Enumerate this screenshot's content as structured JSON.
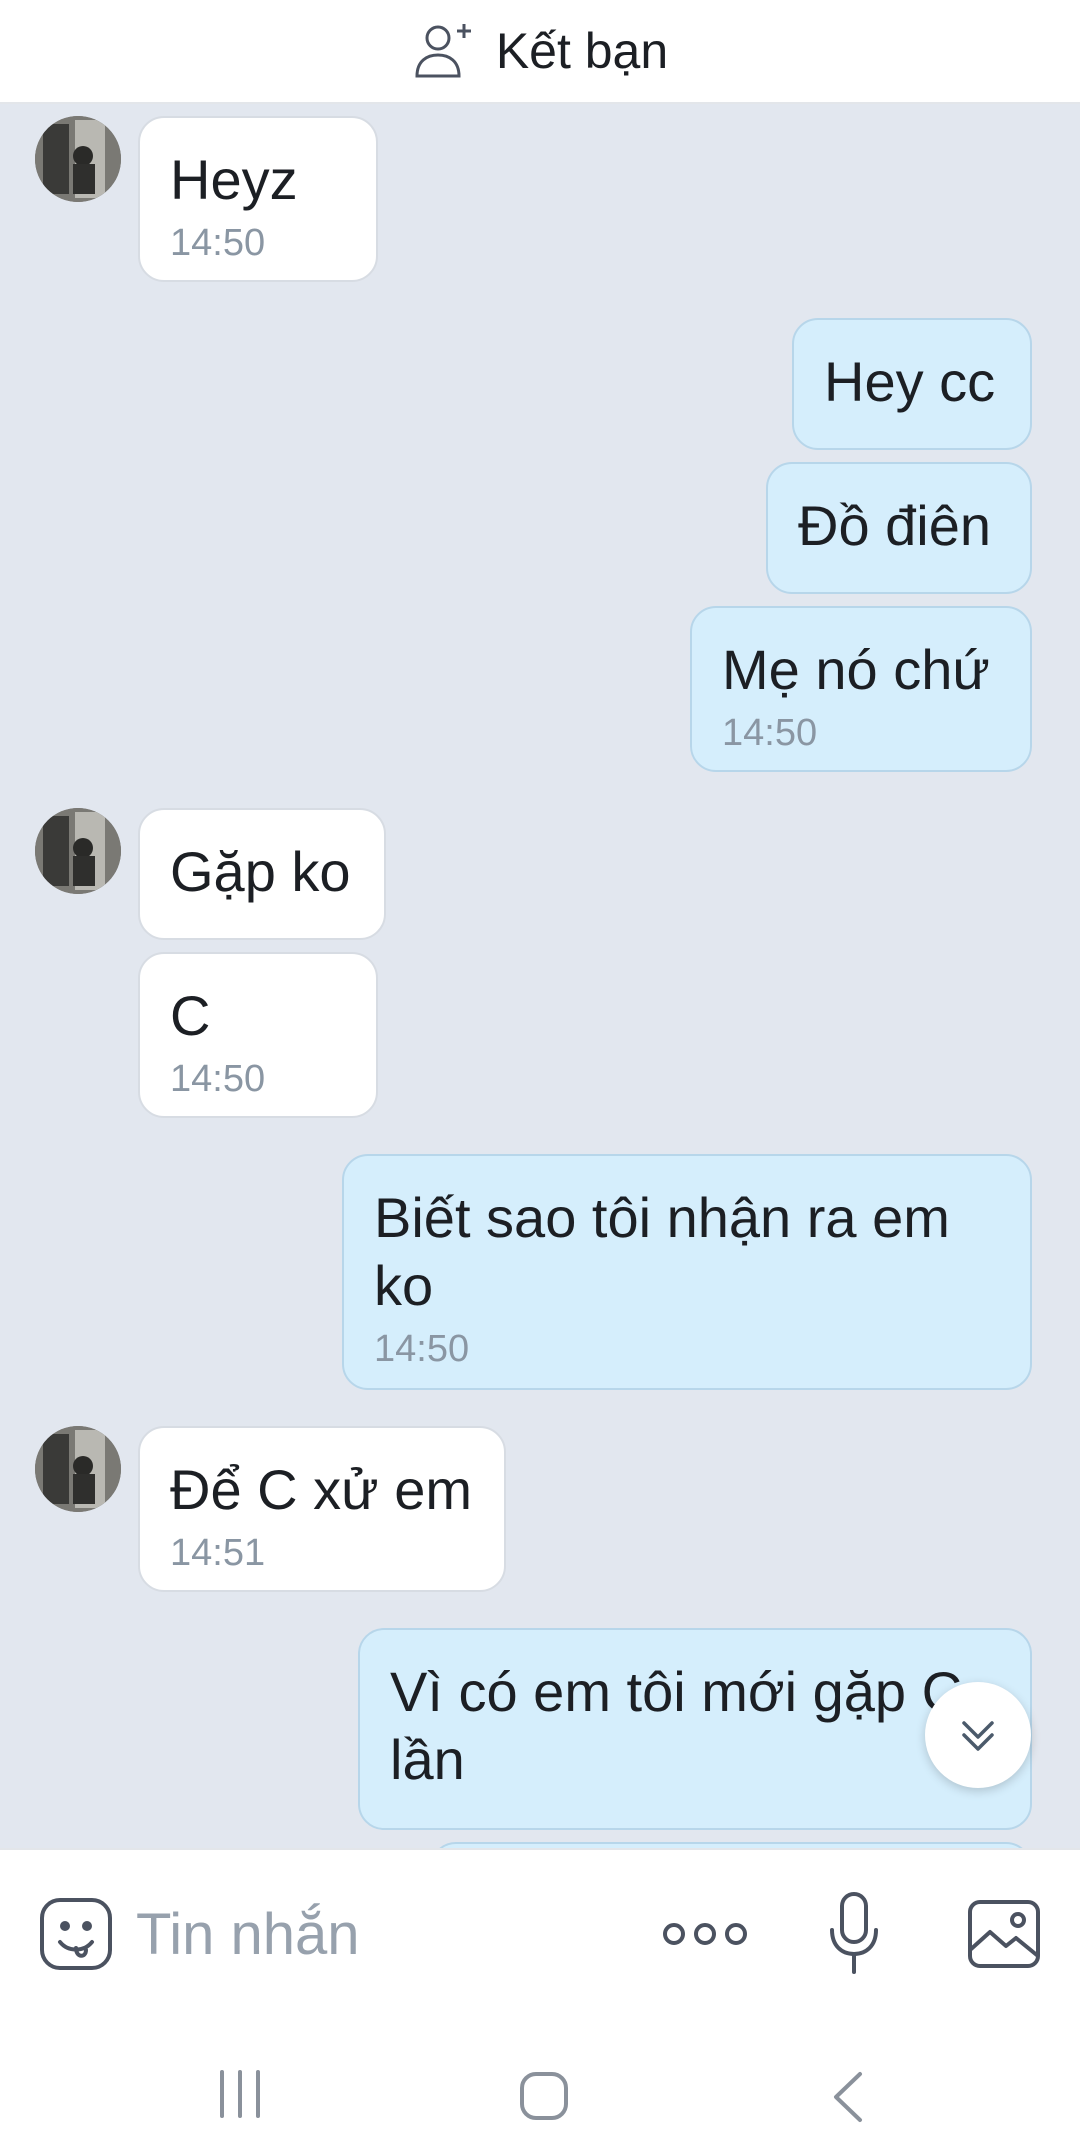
{
  "header": {
    "add_friend_label": "Kết bạn",
    "add_friend_icon": "add-user-icon"
  },
  "messages": [
    {
      "sender": "them",
      "text": "Heyz",
      "time": "14:50"
    },
    {
      "sender": "me",
      "text": "Hey cc",
      "time": ""
    },
    {
      "sender": "me",
      "text": "Đồ điên",
      "time": ""
    },
    {
      "sender": "me",
      "text": "Mẹ nó chứ",
      "time": "14:50"
    },
    {
      "sender": "them",
      "text": "Gặp ko",
      "time": ""
    },
    {
      "sender": "them",
      "text": "C",
      "time": "14:50"
    },
    {
      "sender": "me",
      "text": "Biết sao tôi nhận ra em ko",
      "time": "14:50"
    },
    {
      "sender": "them",
      "text": "Để C xử em",
      "time": "14:51"
    },
    {
      "sender": "me",
      "text": "Vì có em tôi mới gặp C lần",
      "time": ""
    }
  ],
  "composer": {
    "placeholder": "Tin nhắn",
    "value": "",
    "icons": [
      "sticker-icon",
      "more-icon",
      "microphone-icon",
      "image-icon"
    ]
  },
  "scroll_button_icon": "double-chevron-down-icon",
  "navbar": {
    "icons": [
      "recent-apps-icon",
      "home-icon",
      "back-icon"
    ]
  },
  "colors": {
    "chat_background": "#e2e7ef",
    "incoming_bubble": "#ffffff",
    "outgoing_bubble": "#d5eefc",
    "timestamp": "#8a96a3",
    "placeholder": "#97a1ad"
  }
}
